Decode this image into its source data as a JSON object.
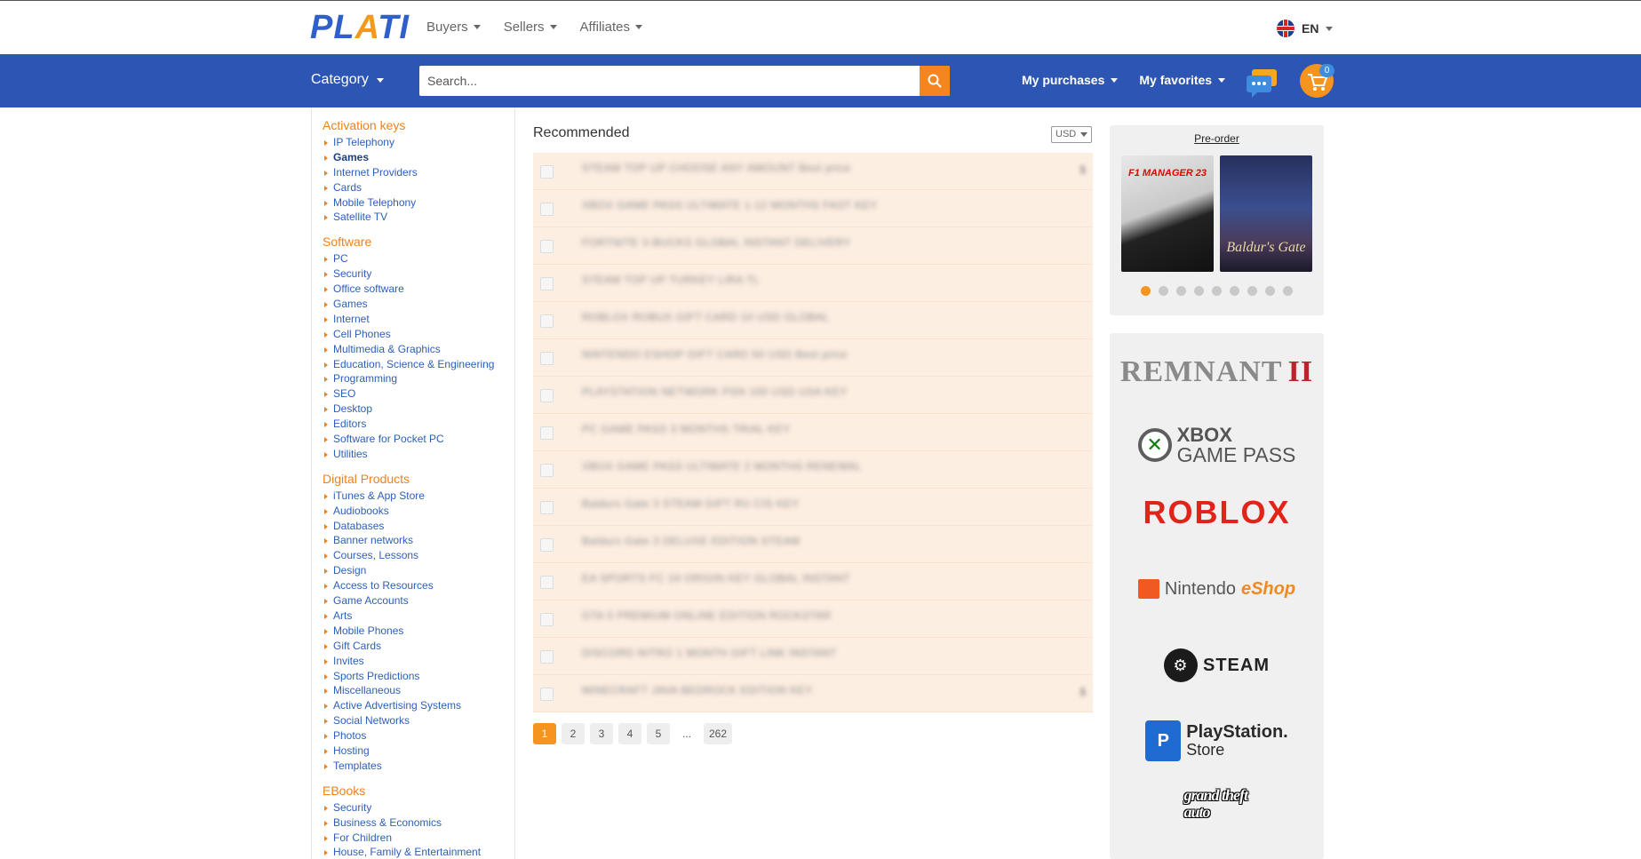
{
  "header": {
    "logo": {
      "left": "PL",
      "accent": "A",
      "right": "TI"
    },
    "nav": [
      {
        "label": "Buyers"
      },
      {
        "label": "Sellers"
      },
      {
        "label": "Affiliates"
      }
    ],
    "language": "EN"
  },
  "bluebar": {
    "category_label": "Category",
    "search_placeholder": "Search...",
    "my_purchases": "My purchases",
    "my_favorites": "My favorites",
    "cart_count": "0"
  },
  "sidebar": {
    "sections": [
      {
        "title": "Activation keys",
        "items": [
          "IP Telephony",
          "Games",
          "Internet Providers",
          "Cards",
          "Mobile Telephony",
          "Satellite TV"
        ]
      },
      {
        "title": "Software",
        "items": [
          "PC",
          "Security",
          "Office software",
          "Games",
          "Internet",
          "Cell Phones",
          "Multimedia & Graphics",
          "Education, Science & Engineering",
          "Programming",
          "SEO",
          "Desktop",
          "Editors",
          "Software for Pocket PC",
          "Utilities"
        ]
      },
      {
        "title": "Digital Products",
        "items": [
          "iTunes & App Store",
          "Audiobooks",
          "Databases",
          "Banner networks",
          "Courses, Lessons",
          "Design",
          "Access to Resources",
          "Game Accounts",
          "Arts",
          "Mobile Phones",
          "Gift Cards",
          "Invites",
          "Sports Predictions",
          "Miscellaneous",
          "Active Advertising Systems",
          "Social Networks",
          "Photos",
          "Hosting",
          "Templates"
        ]
      },
      {
        "title": "EBooks",
        "items": [
          "Security",
          "Business & Economics",
          "For Children",
          "House, Family & Entertainment"
        ]
      }
    ],
    "active_item": "Games"
  },
  "main": {
    "title": "Recommended",
    "currency": "USD",
    "products": [
      {
        "title": "STEAM TOP UP CHOOSE ANY AMOUNT Best price",
        "price": "$"
      },
      {
        "title": "XBOX GAME PASS ULTIMATE 1-12 MONTHS FAST KEY",
        "price": ""
      },
      {
        "title": "FORTNITE V-BUCKS GLOBAL INSTANT DELIVERY",
        "price": ""
      },
      {
        "title": "STEAM TOP UP TURKEY LIRA TL",
        "price": ""
      },
      {
        "title": "ROBLOX ROBUX GIFT CARD 10 USD GLOBAL",
        "price": ""
      },
      {
        "title": "NINTENDO ESHOP GIFT CARD 50 USD Best price",
        "price": ""
      },
      {
        "title": "PLAYSTATION NETWORK PSN 100 USD USA KEY",
        "price": ""
      },
      {
        "title": "PC GAME PASS 3 MONTHS TRIAL KEY",
        "price": ""
      },
      {
        "title": "XBOX GAME PASS ULTIMATE 2 MONTHS RENEWAL",
        "price": ""
      },
      {
        "title": "Baldurs Gate 3 STEAM GIFT RU CIS KEY",
        "price": ""
      },
      {
        "title": "Baldurs Gate 3 DELUXE EDITION STEAM",
        "price": ""
      },
      {
        "title": "EA SPORTS FC 24 ORIGIN KEY GLOBAL INSTANT",
        "price": ""
      },
      {
        "title": "GTA 5 PREMIUM ONLINE EDITION ROCKSTAR",
        "price": ""
      },
      {
        "title": "DISCORD NITRO 1 MONTH GIFT LINK INSTANT",
        "price": ""
      },
      {
        "title": "MINECRAFT JAVA BEDROCK EDITION KEY",
        "price": "$"
      }
    ],
    "pagination": [
      "1",
      "2",
      "3",
      "4",
      "5",
      "...",
      "262"
    ],
    "active_page": "1"
  },
  "right": {
    "preorder_title": "Pre-order",
    "games": [
      {
        "label": "F1 MANAGER 23"
      },
      {
        "label": "Baldur's Gate"
      }
    ],
    "carousel_dots": 9,
    "brands": {
      "remnant": "REMNANT",
      "remnant_num": "II",
      "xbox_1": "XBOX",
      "xbox_2": "GAME PASS",
      "roblox": "ROBLOX",
      "nintendo": "Nintendo",
      "eshop": "eShop",
      "steam": "STEAM",
      "ps_1": "PlayStation.",
      "ps_2": "Store",
      "gta": "grand theft auto"
    }
  },
  "colors": {
    "brand_blue": "#2d56b4",
    "accent_orange": "#f5851f",
    "link_blue": "#2d5fb8",
    "product_bg": "#fdeee2"
  }
}
